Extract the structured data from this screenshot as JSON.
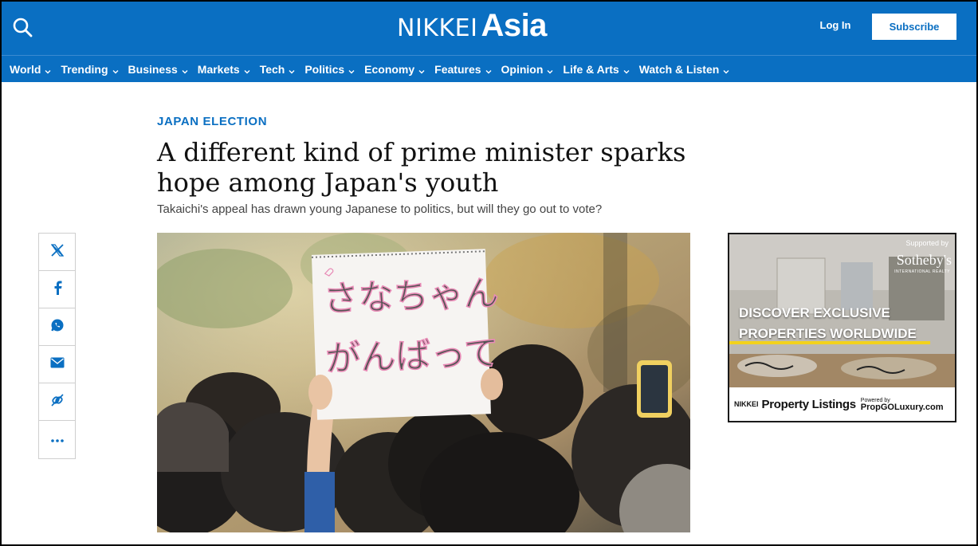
{
  "header": {
    "logo_part1": "NIKKEI",
    "logo_part2": "Asia",
    "login_label": "Log In",
    "subscribe_label": "Subscribe",
    "brand_color": "#0a6fc2"
  },
  "nav": {
    "items": [
      {
        "label": "World"
      },
      {
        "label": "Trending"
      },
      {
        "label": "Business"
      },
      {
        "label": "Markets"
      },
      {
        "label": "Tech"
      },
      {
        "label": "Politics"
      },
      {
        "label": "Economy"
      },
      {
        "label": "Features"
      },
      {
        "label": "Opinion"
      },
      {
        "label": "Life & Arts"
      },
      {
        "label": "Watch & Listen"
      }
    ]
  },
  "article": {
    "kicker": "JAPAN ELECTION",
    "headline": "A different kind of prime minister sparks hope among Japan's youth",
    "subhead": "Takaichi's appeal has drawn young Japanese to politics, but will they go out to vote?"
  },
  "share": {
    "icons": [
      "x-icon",
      "facebook-icon",
      "whatsapp-icon",
      "email-icon",
      "link-icon",
      "more-icon"
    ]
  },
  "hero": {
    "sign_line1": "さなちゃん",
    "sign_line2": "がんばって"
  },
  "ad": {
    "supported_by": "Supported by",
    "brand": "Sotheby's",
    "brand_sub": "INTERNATIONAL REALTY",
    "headline_line1": "DISCOVER EXCLUSIVE",
    "headline_line2": "PROPERTIES WORLDWIDE",
    "footer_nikkei": "NIKKEI",
    "footer_listings": "Property Listings",
    "powered_by": "Powered by",
    "powered_brand": "PropGOLuxury.com",
    "accent_color": "#f2d21d"
  }
}
